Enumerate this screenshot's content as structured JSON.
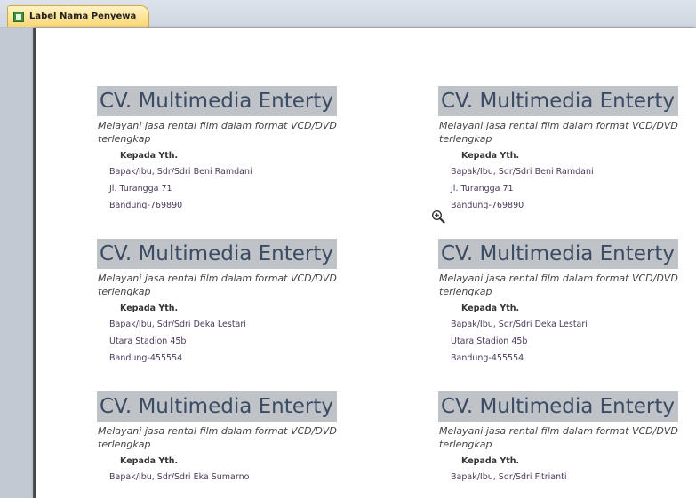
{
  "tab": {
    "icon": "report-icon",
    "title": "Label Nama Penyewa"
  },
  "labels": [
    {
      "company": "CV. Multimedia Enterty",
      "tagline": "Melayani jasa rental film dalam format VCD/DVD terlengkap",
      "greeting": "Kepada Yth.",
      "name": "Bapak/Ibu, Sdr/Sdri Beni Ramdani",
      "address": "Jl. Turangga 71",
      "city": "Bandung-769890"
    },
    {
      "company": "CV. Multimedia Enterty",
      "tagline": "Melayani jasa rental film dalam format VCD/DVD terlengkap",
      "greeting": "Kepada Yth.",
      "name": "Bapak/Ibu, Sdr/Sdri Beni Ramdani",
      "address": "Jl. Turangga 71",
      "city": "Bandung-769890"
    },
    {
      "company": "CV. Multimedia Enterty",
      "tagline": "Melayani jasa rental film dalam format VCD/DVD terlengkap",
      "greeting": "Kepada Yth.",
      "name": "Bapak/Ibu, Sdr/Sdri Deka Lestari",
      "address": "Utara Stadion 45b",
      "city": "Bandung-455554"
    },
    {
      "company": "CV. Multimedia Enterty",
      "tagline": "Melayani jasa rental film dalam format VCD/DVD terlengkap",
      "greeting": "Kepada Yth.",
      "name": "Bapak/Ibu, Sdr/Sdri Deka Lestari",
      "address": "Utara Stadion 45b",
      "city": "Bandung-455554"
    },
    {
      "company": "CV. Multimedia Enterty",
      "tagline": "Melayani jasa rental film dalam format VCD/DVD terlengkap",
      "greeting": "Kepada Yth.",
      "name": "Bapak/Ibu, Sdr/Sdri Eka Sumarno"
    },
    {
      "company": "CV. Multimedia Enterty",
      "tagline": "Melayani jasa rental film dalam format VCD/DVD terlengkap",
      "greeting": "Kepada Yth.",
      "name": "Bapak/Ibu, Sdr/Sdri Fitrianti"
    }
  ],
  "cursor": {
    "icon": "zoom-in-icon"
  },
  "colors": {
    "title_band": "#bfc3c8",
    "title_text": "#3a4b63",
    "tab_active": "#fbd774",
    "background": "#c3c9d2"
  }
}
